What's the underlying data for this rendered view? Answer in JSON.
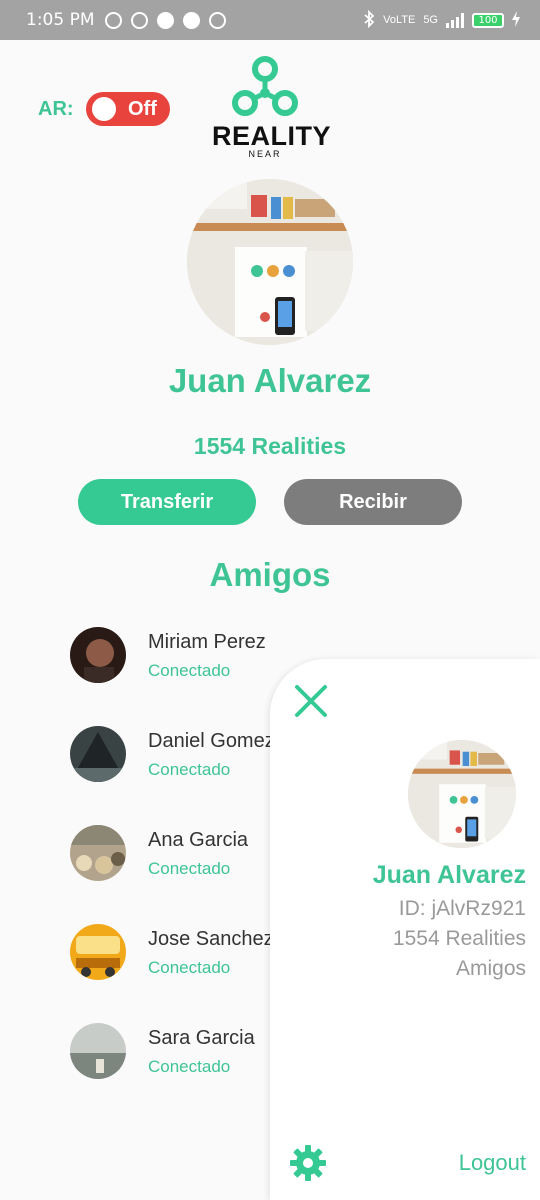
{
  "status_bar": {
    "time": "1:05 PM",
    "network": "5G",
    "volte": "VoLTE",
    "battery": "100"
  },
  "ar": {
    "label": "AR:",
    "state": "Off"
  },
  "logo": {
    "word": "REALITY",
    "sub": "NEAR"
  },
  "profile": {
    "name": "Juan Alvarez",
    "realities": "1554 Realities",
    "transfer_label": "Transferir",
    "receive_label": "Recibir"
  },
  "friends": {
    "title": "Amigos",
    "items": [
      {
        "name": "Miriam Perez",
        "status": "Conectado"
      },
      {
        "name": "Daniel Gomez",
        "status": "Conectado"
      },
      {
        "name": "Ana Garcia",
        "status": "Conectado"
      },
      {
        "name": "Jose Sanchez",
        "status": "Conectado"
      },
      {
        "name": "Sara Garcia",
        "status": "Conectado"
      }
    ]
  },
  "drawer": {
    "name": "Juan Alvarez",
    "id": "ID: jAlvRz921",
    "realities": "1554 Realities",
    "amigos": "Amigos",
    "logout": "Logout"
  },
  "colors": {
    "accent": "#3ec495",
    "toggle_off": "#e8433c",
    "button_secondary": "#7d7d7d",
    "status_bar": "#a3a3a3"
  }
}
